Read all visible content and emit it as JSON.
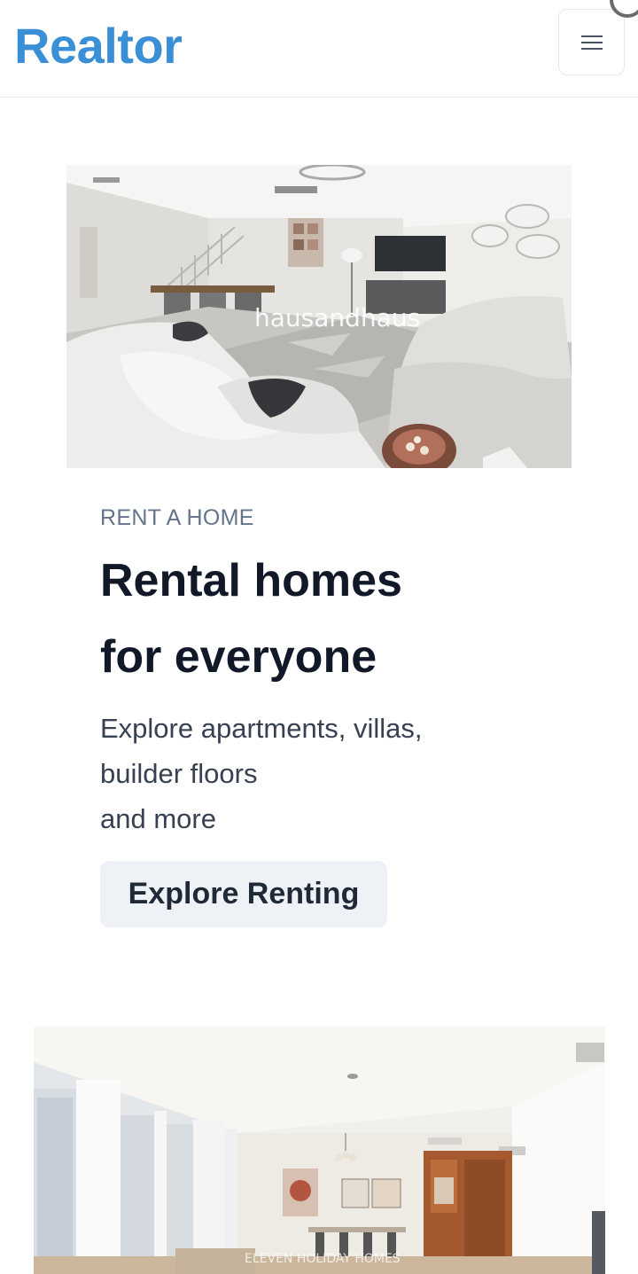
{
  "header": {
    "brand": "Realtor",
    "menu_icon": "hamburger-menu-icon",
    "brand_color": "#3b8fd6"
  },
  "hero": {
    "image_alt": "Living room with white sectional sofa",
    "image_watermark": "hausandhaus",
    "eyebrow": "RENT A HOME",
    "title_line1": "Rental homes",
    "title_line2": "for everyone",
    "desc_line1": "Explore apartments, villas,",
    "desc_line2": "builder floors",
    "desc_line3": "and more",
    "cta_label": "Explore Renting"
  },
  "second_card": {
    "image_alt": "Bright apartment dining area with curtains",
    "image_watermark": "ELEVEN HOLIDAY HOMES"
  }
}
